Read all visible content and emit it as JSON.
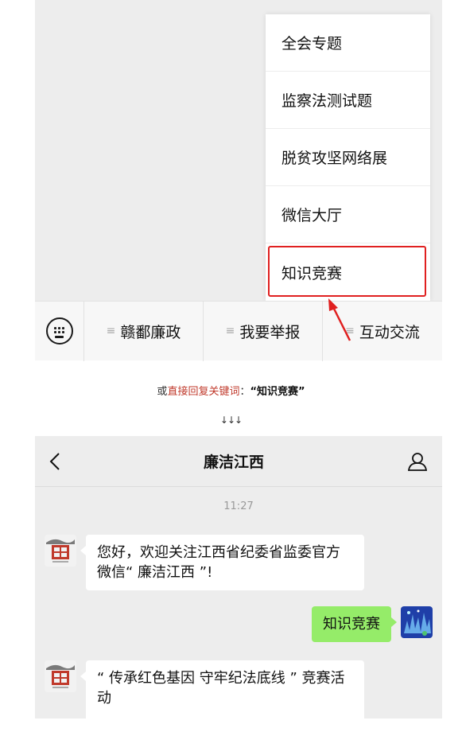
{
  "menu_popup": {
    "items": [
      "全会专题",
      "监察法测试题",
      "脱贫攻坚网络展",
      "微信大厅",
      "知识竞赛"
    ]
  },
  "menu_bar": {
    "keyboard_icon": "keyboard-icon",
    "items": [
      "赣鄱廉政",
      "我要举报",
      "互动交流"
    ]
  },
  "instruction": {
    "prefix": "或",
    "highlight": "直接回复关键词",
    "colon": "：",
    "keyword": "“知识竞赛”"
  },
  "down_arrows": "↓↓↓",
  "chat": {
    "title": "廉洁江西",
    "back_icon": "chevron-left-icon",
    "profile_icon": "person-icon",
    "time": "11:27",
    "messages": [
      {
        "side": "left",
        "text": "您好，欢迎关注江西省纪委省监委官方微信“ 廉洁江西 ”!"
      },
      {
        "side": "right",
        "text": "知识竞赛"
      },
      {
        "side": "left",
        "text": "“ 传承红色基因  守牢纪法底线 ” 竞赛活动"
      }
    ],
    "account_logo_text": "廉洁江西"
  },
  "colors": {
    "highlight_red": "#e02020",
    "bubble_green": "#95ec69",
    "instruction_red": "#c0392b",
    "background_gray": "#ededed"
  }
}
